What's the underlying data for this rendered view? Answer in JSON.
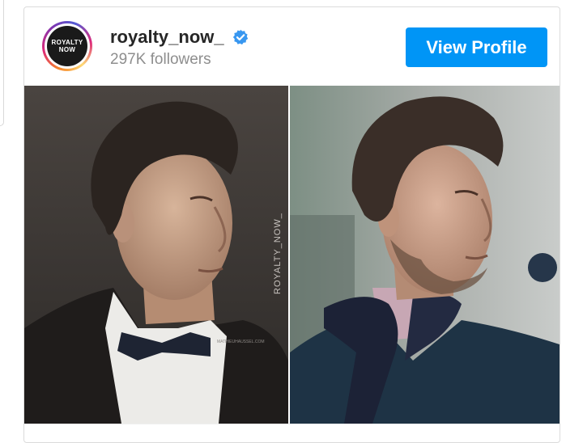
{
  "account": {
    "avatar_text_line1": "ROYALTY",
    "avatar_text_line2": "NOW",
    "username": "royalty_now_",
    "verified": true,
    "followers": "297K followers"
  },
  "actions": {
    "view_profile_label": "View Profile"
  },
  "post_image": {
    "left_panel_watermark": "ROYALTY_NOW_",
    "left_panel_signature": "MATHIEUHAUSSEL.COM"
  },
  "colors": {
    "button_blue": "#0095f6",
    "verified_blue": "#3897f0",
    "username": "#262626",
    "followers_gray": "#8e8e8e"
  },
  "icons": {
    "verified": "verified-badge-icon"
  }
}
